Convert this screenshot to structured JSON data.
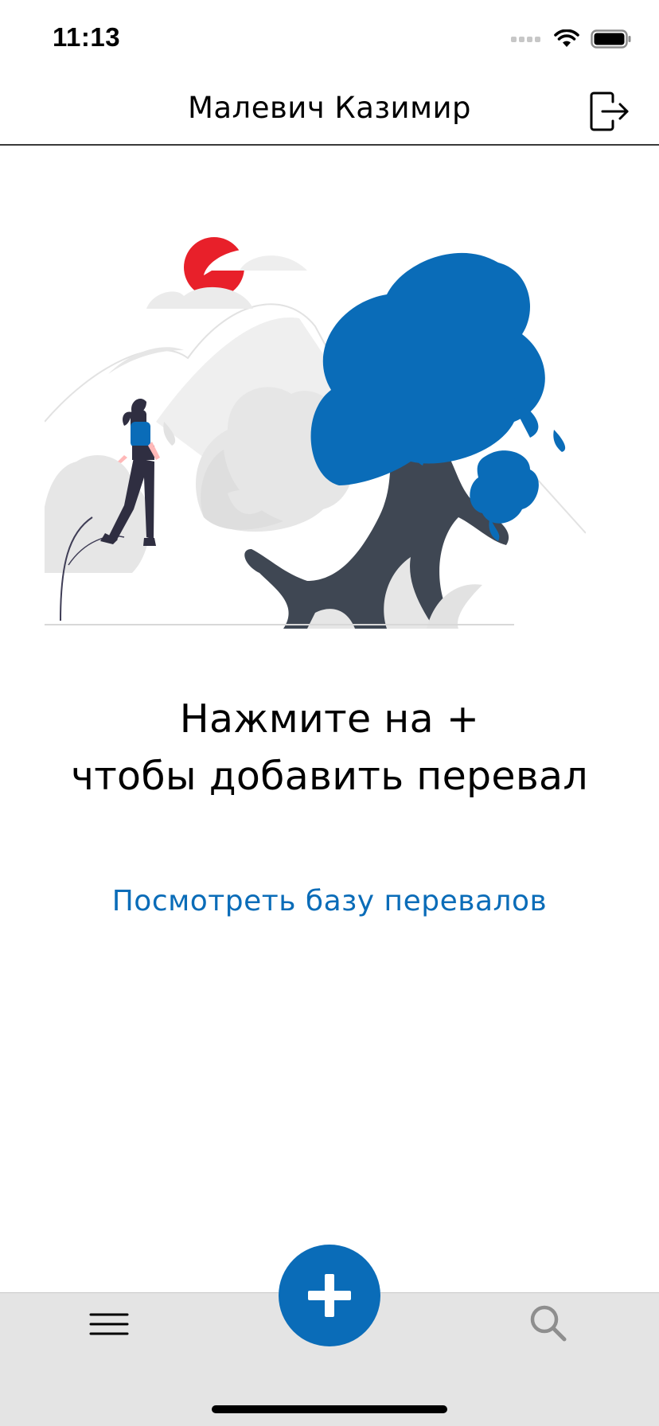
{
  "status_bar": {
    "time": "11:13"
  },
  "nav": {
    "title": "Малевич Казимир",
    "logout_icon": "logout-icon"
  },
  "empty_state": {
    "line1": "Нажмите на +",
    "line2": "чтобы добавить перевал",
    "link": "Посмотреть базу перевалов"
  },
  "tab_bar": {
    "menu_icon": "hamburger-menu-icon",
    "add_icon": "plus-icon",
    "search_icon": "search-icon"
  },
  "colors": {
    "accent": "#0a6cb8",
    "sun": "#e8202a",
    "tree_trunk": "#3f4753",
    "tab_bar_bg": "#e4e4e4"
  }
}
